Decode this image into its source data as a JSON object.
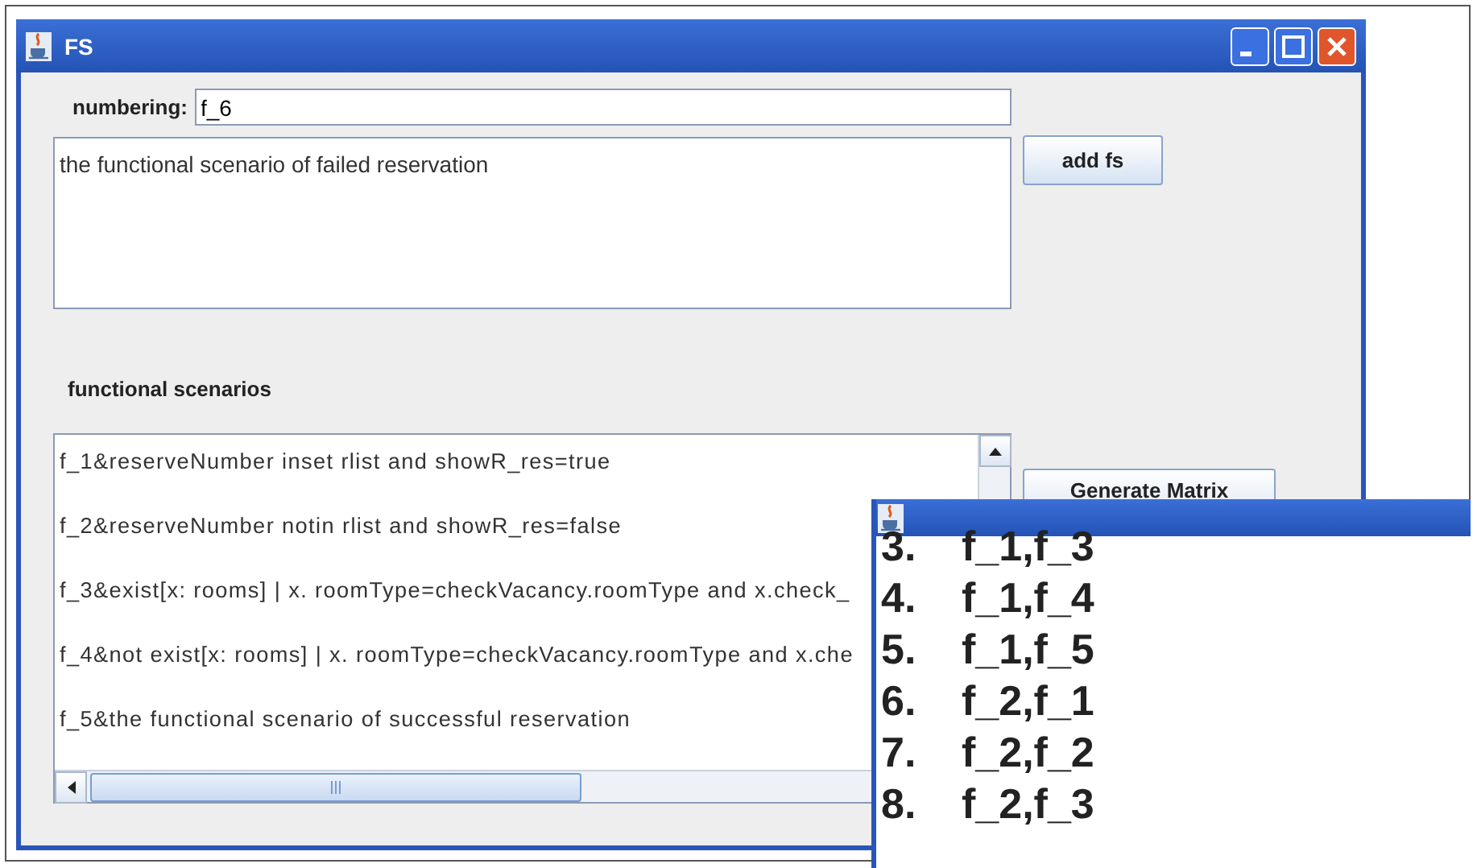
{
  "main_window": {
    "title": "FS",
    "numbering": {
      "label": "numbering:",
      "value": "f_6"
    },
    "description": {
      "value": "the functional scenario of failed reservation"
    },
    "add_button": "add fs",
    "scenarios": {
      "label": "functional scenarios",
      "items": [
        "f_1&reserveNumber inset rlist and showR_res=true",
        "f_2&reserveNumber notin rlist and showR_res=false",
        "f_3&exist[x: rooms] | x. roomType=checkVacancy.roomType and x.check_",
        "f_4&not exist[x: rooms] | x. roomType=checkVacancy.roomType and x.che",
        "f_5&the functional scenario of  successful reservation"
      ]
    },
    "generate_button": "Generate Matrix"
  },
  "matrix_window": {
    "items": [
      {
        "number": "3.",
        "pair": "f_1,f_3"
      },
      {
        "number": "4.",
        "pair": "f_1,f_4"
      },
      {
        "number": "5.",
        "pair": "f_1,f_5"
      },
      {
        "number": "6.",
        "pair": "f_2,f_1"
      },
      {
        "number": "7.",
        "pair": "f_2,f_2"
      },
      {
        "number": "8.",
        "pair": "f_2,f_3"
      }
    ]
  }
}
